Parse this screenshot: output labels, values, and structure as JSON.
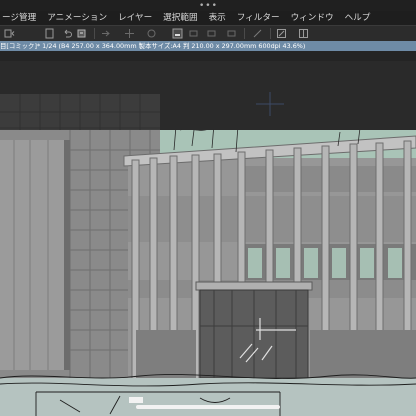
{
  "status_bar": {
    "grabber": "•••"
  },
  "menu": {
    "items": [
      {
        "label": "ージ管理"
      },
      {
        "label": "アニメーション"
      },
      {
        "label": "レイヤー"
      },
      {
        "label": "選択範囲"
      },
      {
        "label": "表示"
      },
      {
        "label": "フィルター"
      },
      {
        "label": "ウィンドウ"
      },
      {
        "label": "ヘルプ"
      }
    ]
  },
  "toolbar": {
    "icons": [
      "toolbar-back-icon",
      "toolbar-page-icon",
      "toolbar-undo-icon",
      "toolbar-redo-icon",
      "toolbar-blank-icon",
      "toolbar-transform-icon",
      "toolbar-fill-icon",
      "toolbar-select-icon",
      "toolbar-layer-icon",
      "toolbar-eraser-icon",
      "toolbar-pen-icon",
      "toolbar-rotate-icon",
      "toolbar-flip-icon"
    ]
  },
  "document": {
    "title": "目[コミック]* 1/24 (B4 257.00 x 364.00mm 製本サイズ:A4 判 210.00 x 297.00mm 600dpi 43.6%)"
  },
  "colors": {
    "menu_bg": "#1e1e1e",
    "tab_bg": "#6e8ba6",
    "canvas_sky": "#a9c4b7",
    "building": "#8c8c8c"
  }
}
